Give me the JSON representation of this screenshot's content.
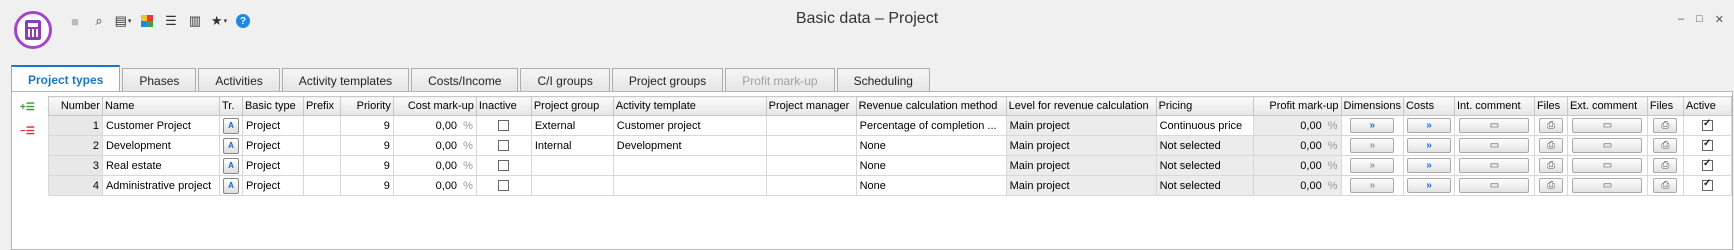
{
  "window": {
    "title": "Basic data – Project",
    "controls": [
      "–",
      "□",
      "✕"
    ]
  },
  "toolbar": [
    {
      "icon": "save-icon",
      "glyph": "■",
      "enabled": false
    },
    {
      "icon": "search-icon",
      "glyph": "⌕",
      "enabled": true
    },
    {
      "icon": "view-icon",
      "glyph": "▤",
      "enabled": true,
      "dropdown": true
    },
    {
      "icon": "color-grid-icon",
      "glyph": "",
      "enabled": true
    },
    {
      "icon": "filter-settings-icon",
      "glyph": "☰",
      "enabled": true
    },
    {
      "icon": "book-icon",
      "glyph": "▥",
      "enabled": true
    },
    {
      "icon": "favorites-icon",
      "glyph": "★",
      "enabled": true,
      "dropdown": true
    },
    {
      "icon": "help-icon",
      "glyph": "?",
      "enabled": true
    }
  ],
  "tabs": [
    {
      "label": "Project types",
      "active": true,
      "disabled": false
    },
    {
      "label": "Phases",
      "active": false,
      "disabled": false
    },
    {
      "label": "Activities",
      "active": false,
      "disabled": false
    },
    {
      "label": "Activity templates",
      "active": false,
      "disabled": false
    },
    {
      "label": "Costs/Income",
      "active": false,
      "disabled": false
    },
    {
      "label": "C/I groups",
      "active": false,
      "disabled": false
    },
    {
      "label": "Project groups",
      "active": false,
      "disabled": false
    },
    {
      "label": "Profit mark-up",
      "active": false,
      "disabled": true
    },
    {
      "label": "Scheduling",
      "active": false,
      "disabled": false
    }
  ],
  "side": {
    "add": "+☰",
    "remove": "−☰"
  },
  "table": {
    "columns": [
      "Number",
      "Name",
      "Tr.",
      "Basic type",
      "Prefix",
      "Priority",
      "Cost mark-up",
      "Inactive",
      "Project group",
      "Activity template",
      "Project manager",
      "Revenue calculation method",
      "Level for revenue calculation",
      "Pricing",
      "Profit mark-up",
      "Dimensions",
      "Costs",
      "Int. comment",
      "Files",
      "Ext. comment",
      "Files",
      "Active"
    ],
    "percent_sign": "%",
    "rows": [
      {
        "number": "1",
        "name": "Customer Project",
        "basic_type": "Project",
        "prefix": "",
        "priority": "9",
        "cost_markup": "0,00",
        "inactive": false,
        "project_group": "External",
        "activity_template": "Customer project",
        "project_manager": "",
        "revenue_method": "Percentage of completion ...",
        "revenue_level": "Main project",
        "pricing": "Continuous price",
        "profit_markup": "0,00",
        "dimensions_active": true,
        "active": true
      },
      {
        "number": "2",
        "name": "Development",
        "basic_type": "Project",
        "prefix": "",
        "priority": "9",
        "cost_markup": "0,00",
        "inactive": false,
        "project_group": "Internal",
        "activity_template": "Development",
        "project_manager": "",
        "revenue_method": "None",
        "revenue_level": "Main project",
        "pricing": "Not selected",
        "profit_markup": "0,00",
        "dimensions_active": false,
        "active": true
      },
      {
        "number": "3",
        "name": "Real estate",
        "basic_type": "Project",
        "prefix": "",
        "priority": "9",
        "cost_markup": "0,00",
        "inactive": false,
        "project_group": "",
        "activity_template": "",
        "project_manager": "",
        "revenue_method": "None",
        "revenue_level": "Main project",
        "pricing": "Not selected",
        "profit_markup": "0,00",
        "dimensions_active": false,
        "active": true
      },
      {
        "number": "4",
        "name": "Administrative project",
        "basic_type": "Project",
        "prefix": "",
        "priority": "9",
        "cost_markup": "0,00",
        "inactive": false,
        "project_group": "",
        "activity_template": "",
        "project_manager": "",
        "revenue_method": "None",
        "revenue_level": "Main project",
        "pricing": "Not selected",
        "profit_markup": "0,00",
        "dimensions_active": false,
        "active": true
      }
    ]
  }
}
